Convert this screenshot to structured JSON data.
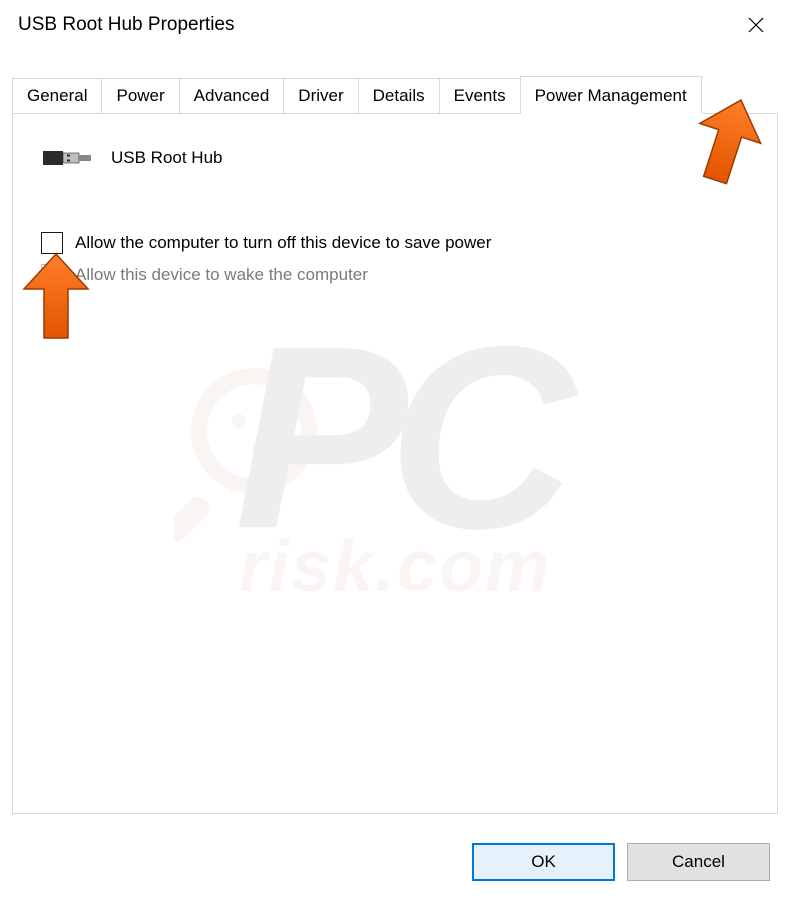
{
  "window": {
    "title": "USB Root Hub Properties"
  },
  "tabs": [
    {
      "label": "General",
      "active": false
    },
    {
      "label": "Power",
      "active": false
    },
    {
      "label": "Advanced",
      "active": false
    },
    {
      "label": "Driver",
      "active": false
    },
    {
      "label": "Details",
      "active": false
    },
    {
      "label": "Events",
      "active": false
    },
    {
      "label": "Power Management",
      "active": true
    }
  ],
  "device": {
    "name": "USB Root Hub",
    "icon": "usb-plug-icon"
  },
  "options": {
    "allow_turn_off": {
      "label": "Allow the computer to turn off this device to save power",
      "checked": false,
      "enabled": true
    },
    "allow_wake": {
      "label": "Allow this device to wake the computer",
      "checked": false,
      "enabled": false
    }
  },
  "buttons": {
    "ok": "OK",
    "cancel": "Cancel"
  },
  "watermark": {
    "main": "PC",
    "domain": "risk.com"
  }
}
